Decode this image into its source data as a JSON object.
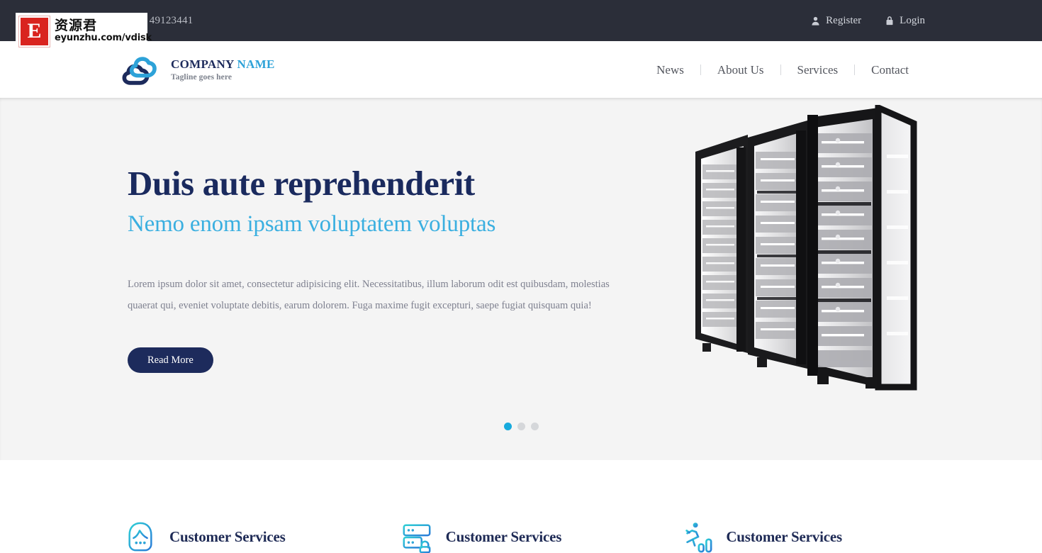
{
  "watermark": {
    "badge_letter": "E",
    "chinese_text": "资源君",
    "url": "eyunzhu.com/vdisk"
  },
  "topbar": {
    "phone": ": (800) 49123441",
    "links": [
      {
        "label": "Register",
        "icon": "user-icon"
      },
      {
        "label": "Login",
        "icon": "lock-icon"
      }
    ]
  },
  "header": {
    "logo_icon": "cloud-logo-icon",
    "brand_primary": "COMPANY",
    "brand_accent": "NAME",
    "tagline": "Tagline goes here",
    "nav": [
      {
        "label": "News"
      },
      {
        "label": "About Us"
      },
      {
        "label": "Services"
      },
      {
        "label": "Contact"
      }
    ]
  },
  "hero": {
    "title": "Duis aute reprehenderit",
    "subtitle": "Nemo enom ipsam voluptatem voluptas",
    "body": "Lorem ipsum dolor sit amet, consectetur adipisicing elit. Necessitatibus, illum laborum odit est quibusdam, molestias quaerat qui, eveniet voluptate debitis, earum dolorem. Fuga maxime fugit excepturi, saepe fugiat quisquam quia!",
    "button_label": "Read More",
    "image_alt": "server-racks-image",
    "slides": [
      {
        "active": true
      },
      {
        "active": false
      },
      {
        "active": false
      }
    ]
  },
  "services": [
    {
      "title": "Customer Services",
      "icon": "support-face-icon"
    },
    {
      "title": "Customer Services",
      "icon": "server-lock-icon"
    },
    {
      "title": "Customer Services",
      "icon": "runner-chart-icon"
    }
  ],
  "colors": {
    "topbar_bg": "#2b2e39",
    "navy": "#1d2b5c",
    "accent_blue": "#2da2d8",
    "hero_bg": "#f4f4f4",
    "dot_active": "#17aadd",
    "watermark_red": "#d9241f"
  }
}
